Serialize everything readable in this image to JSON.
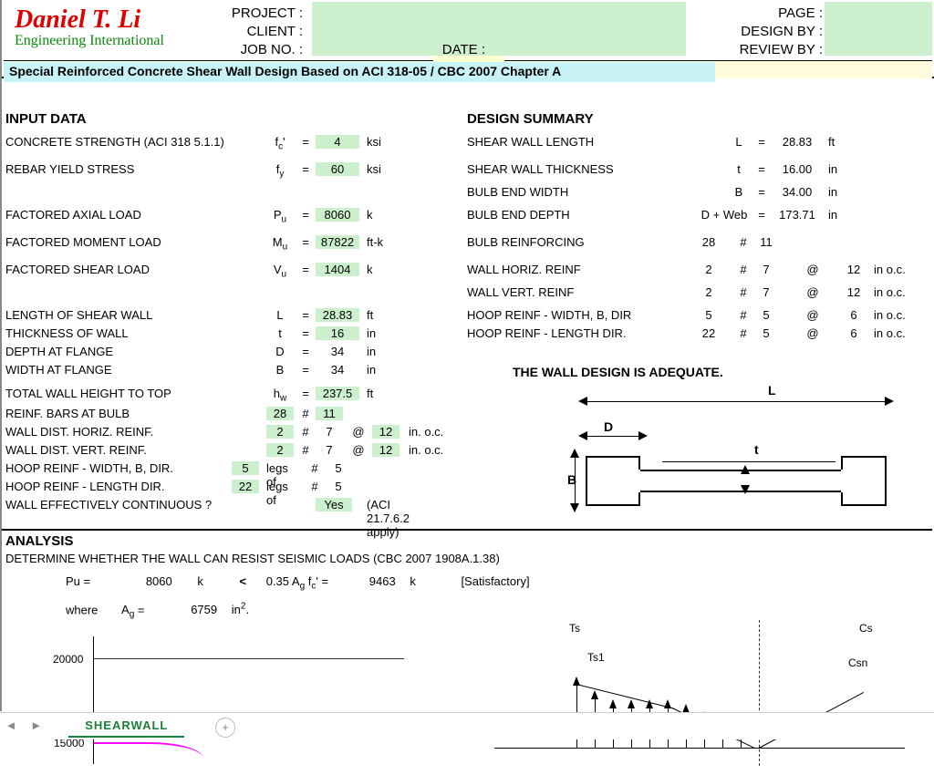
{
  "header": {
    "logo_name": "Daniel T. Li",
    "logo_sub": "Engineering International",
    "project_lbl": "PROJECT :",
    "client_lbl": "CLIENT :",
    "jobno_lbl": "JOB NO. :",
    "date_lbl": "DATE :",
    "page_lbl": "PAGE :",
    "design_lbl": "DESIGN BY :",
    "review_lbl": "REVIEW BY :"
  },
  "title": "Special Reinforced Concrete Shear Wall Design Based on ACI 318-05 / CBC 2007 Chapter A",
  "section": {
    "input": "INPUT DATA",
    "design": "DESIGN SUMMARY",
    "analysis": "ANALYSIS"
  },
  "input_rows": {
    "conc": {
      "label": "CONCRETE STRENGTH (ACI 318 5.1.1)",
      "sym": "f",
      "sub": "c",
      "prime": "'",
      "val": "4",
      "unit": "ksi"
    },
    "rebar": {
      "label": "REBAR YIELD STRESS",
      "sym": "f",
      "sub": "y",
      "val": "60",
      "unit": "ksi"
    },
    "pu": {
      "label": "FACTORED AXIAL LOAD",
      "sym": "P",
      "sub": "u",
      "val": "8060",
      "unit": "k"
    },
    "mu": {
      "label": "FACTORED MOMENT LOAD",
      "sym": "M",
      "sub": "u",
      "val": "87822",
      "unit": "ft-k"
    },
    "vu": {
      "label": "FACTORED SHEAR LOAD",
      "sym": "V",
      "sub": "u",
      "val": "1404",
      "unit": "k"
    },
    "L": {
      "label": "LENGTH OF SHEAR WALL",
      "sym": "L",
      "val": "28.83",
      "unit": "ft"
    },
    "t": {
      "label": "THICKNESS OF WALL",
      "sym": "t",
      "val": "16",
      "unit": "in"
    },
    "D": {
      "label": "DEPTH AT FLANGE",
      "sym": "D",
      "val": "34",
      "unit": "in"
    },
    "B": {
      "label": "WIDTH AT FLANGE",
      "sym": "B",
      "val": "34",
      "unit": "in"
    },
    "hw": {
      "label": "TOTAL WALL HEIGHT TO TOP",
      "sym": "h",
      "sub": "w",
      "val": "237.5",
      "unit": "ft"
    },
    "bulb": {
      "label": "REINF.  BARS AT BULB",
      "n": "28",
      "hash": "#",
      "size": "11"
    },
    "whor": {
      "label": "WALL DIST. HORIZ. REINF.",
      "n": "2",
      "hash": "#",
      "size": "7",
      "at": "@",
      "sp": "12",
      "unit": "in. o.c."
    },
    "wver": {
      "label": "WALL DIST. VERT. REINF.",
      "n": "2",
      "hash": "#",
      "size": "7",
      "at": "@",
      "sp": "12",
      "unit": "in. o.c."
    },
    "hoopB": {
      "label": "HOOP REINF - WIDTH, B, DIR.",
      "n": "5",
      "legs": "legs of",
      "hash": "#",
      "size": "5"
    },
    "hoopL": {
      "label": "HOOP REINF - LENGTH DIR.",
      "n": "22",
      "legs": "legs of",
      "hash": "#",
      "size": "5"
    },
    "cont": {
      "label": "WALL EFFECTIVELY CONTINUOUS ?",
      "val": "Yes",
      "note": "(ACI 21.7.6.2 apply)"
    }
  },
  "summary_rows": {
    "L": {
      "label": "SHEAR WALL LENGTH",
      "sym": "L",
      "eq": "=",
      "val": "28.83",
      "unit": "ft"
    },
    "t": {
      "label": "SHEAR WALL THICKNESS",
      "sym": "t",
      "eq": "=",
      "val": "16.00",
      "unit": "in"
    },
    "B": {
      "label": "BULB END WIDTH",
      "sym": "B",
      "eq": "=",
      "val": "34.00",
      "unit": "in"
    },
    "D": {
      "label": "BULB END DEPTH",
      "sym": "D + Web",
      "eq": "=",
      "val": "173.71",
      "unit": "in"
    },
    "bulb": {
      "label": "BULB REINFORCING",
      "n": "28",
      "hash": "#",
      "size": "11"
    },
    "whor": {
      "label": "WALL HORIZ. REINF",
      "n": "2",
      "hash": "#",
      "size": "7",
      "at": "@",
      "sp": "12",
      "unit": "in o.c."
    },
    "wver": {
      "label": "WALL VERT. REINF",
      "n": "2",
      "hash": "#",
      "size": "7",
      "at": "@",
      "sp": "12",
      "unit": "in o.c."
    },
    "hoopB": {
      "label": "HOOP REINF - WIDTH, B, DIR",
      "n": "5",
      "hash": "#",
      "size": "5",
      "at": "@",
      "sp": "6",
      "unit": "in o.c."
    },
    "hoopL": {
      "label": "HOOP REINF - LENGTH DIR.",
      "n": "22",
      "hash": "#",
      "size": "5",
      "at": "@",
      "sp": "6",
      "unit": "in o.c."
    }
  },
  "adequate": "THE WALL DESIGN IS ADEQUATE.",
  "cross_labels": {
    "L": "L",
    "D": "D",
    "B": "B",
    "t": "t"
  },
  "analysis": {
    "sub": "DETERMINE WHETHER THE WALL CAN RESIST SEISMIC LOADS (CBC 2007 1908A.1.38)",
    "pu_lhs": "Pu =",
    "pu_val": "8060",
    "pu_k": "k",
    "lt": "<",
    "rhs_expr": "0.35 A",
    "rhs_sub": "g",
    "rhs_f": " f",
    "rhs_csub": "c",
    "rhs_prime": "' =",
    "rhs_val": "9463",
    "rhs_k": "k",
    "sat": "[Satisfactory]",
    "where": "where",
    "Ag": "A",
    "Ag_sub": "g",
    "Ag_eq": "  =",
    "Ag_val": "6759",
    "Ag_unit": "in",
    "Ag_sup": "2",
    "dot": "."
  },
  "chart_data": {
    "type": "line",
    "axes": {
      "y_ticks": [
        15000,
        20000
      ]
    },
    "note": "interaction curve stub"
  },
  "beam_labels": {
    "Ts": "Ts",
    "Ts1": "Ts1",
    "Cs": "Cs",
    "Csn": "Csn"
  },
  "tab": {
    "name": "SHEARWALL"
  }
}
